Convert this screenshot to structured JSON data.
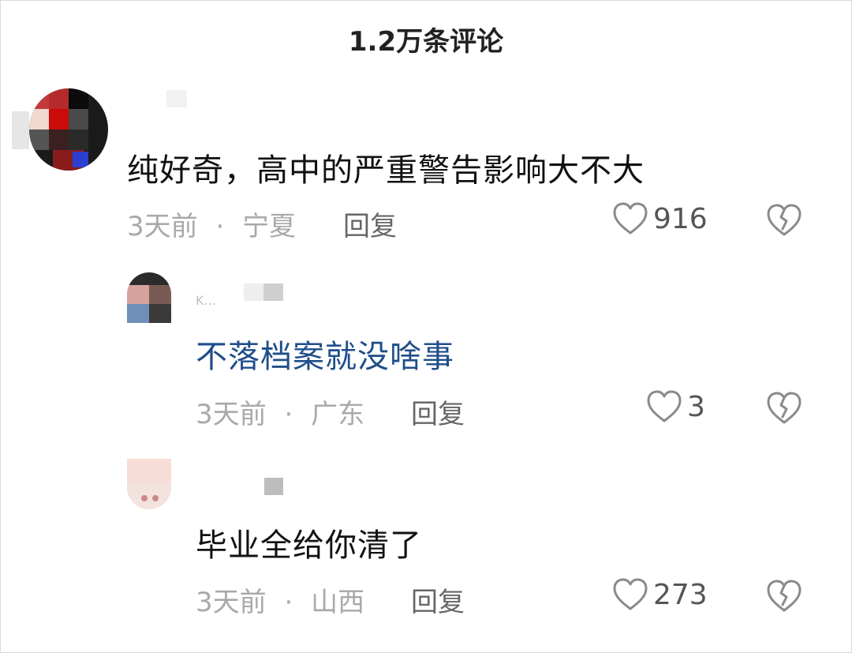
{
  "header": {
    "title": "1.2万条评论"
  },
  "comments": [
    {
      "text": "纯好奇，高中的严重警告影响大不大",
      "time": "3天前",
      "location": "宁夏",
      "reply_label": "回复",
      "likes": "916"
    },
    {
      "username": "K…",
      "text": "不落档案就没啥事",
      "time": "3天前",
      "location": "广东",
      "reply_label": "回复",
      "likes": "3"
    },
    {
      "text": "毕业全给你清了",
      "time": "3天前",
      "location": "山西",
      "reply_label": "回复",
      "likes": "273"
    }
  ],
  "meta_separator": "·",
  "colors": {
    "title": "#222222",
    "body_text": "#111111",
    "link_text": "#1f4e89",
    "meta": "#a9a9a9",
    "icon": "#8a8a8a"
  },
  "icons": {
    "like": "heart-outline-icon",
    "dislike": "broken-heart-icon"
  }
}
